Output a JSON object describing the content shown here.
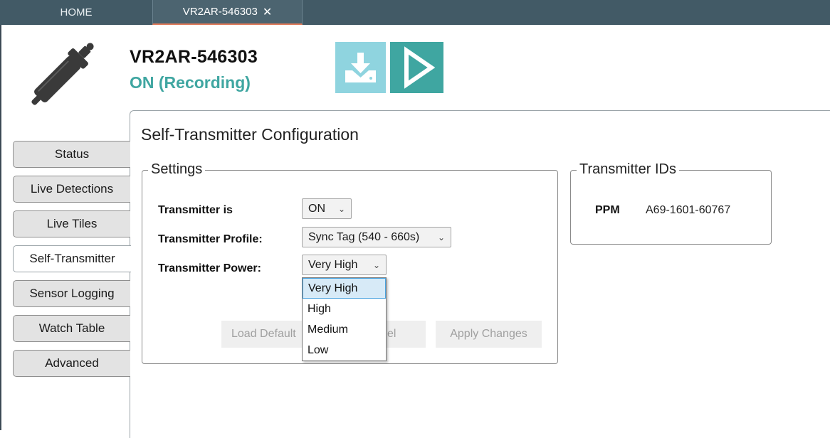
{
  "tabs": {
    "home_label": "HOME",
    "device_label": "VR2AR-546303",
    "close_glyph": "✕"
  },
  "header": {
    "device_name": "VR2AR-546303",
    "status": "ON (Recording)",
    "icons": [
      "receiver-device-icon",
      "download-icon",
      "play-icon"
    ]
  },
  "nav": {
    "items": [
      "Status",
      "Live Detections",
      "Live Tiles",
      "Self-Transmitter",
      "Sensor Logging",
      "Watch Table",
      "Advanced"
    ],
    "active": "Self-Transmitter"
  },
  "main": {
    "title": "Self-Transmitter Configuration",
    "settings": {
      "legend": "Settings",
      "fields": [
        {
          "label": "Transmitter is",
          "value": "ON"
        },
        {
          "label": "Transmitter Profile:",
          "value": "Sync Tag (540 - 660s)"
        },
        {
          "label": "Transmitter Power:",
          "value": "Very High"
        }
      ],
      "power_options": [
        "Very High",
        "High",
        "Medium",
        "Low"
      ],
      "power_selected": "Very High",
      "buttons": {
        "load_defaults_visible": "Load Default",
        "cancel_visible": "el",
        "apply": "Apply Changes"
      }
    },
    "transmitter_ids": {
      "legend": "Transmitter IDs",
      "entries": [
        {
          "key": "PPM",
          "value": "A69-1601-60767"
        }
      ]
    }
  },
  "colors": {
    "tabbar": "#425a66",
    "status_accent": "#3fa6a1",
    "download_button": "#8fd4df",
    "play_button": "#3fa6a1",
    "tab_underline": "#e07b5a"
  }
}
